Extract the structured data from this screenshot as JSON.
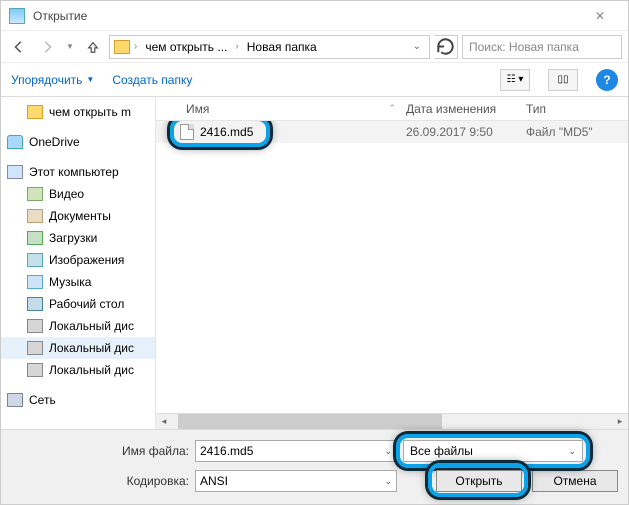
{
  "titlebar": {
    "title": "Открытие"
  },
  "nav": {
    "path_segments": [
      "чем открыть ...",
      "Новая папка"
    ],
    "search_placeholder": "Поиск: Новая папка"
  },
  "toolbar": {
    "organize": "Упорядочить",
    "new_folder": "Создать папку"
  },
  "sidebar": [
    {
      "id": "folder-root",
      "label": "чем открыть m",
      "icon": "folder",
      "indent": 1,
      "hl": false
    },
    {
      "id": "onedrive",
      "label": "OneDrive",
      "icon": "onedrive",
      "indent": 0,
      "hl": false,
      "gap": true
    },
    {
      "id": "this-pc",
      "label": "Этот компьютер",
      "icon": "pc",
      "indent": 0,
      "hl": false,
      "gap": true
    },
    {
      "id": "videos",
      "label": "Видео",
      "icon": "video",
      "indent": 1,
      "hl": false
    },
    {
      "id": "documents",
      "label": "Документы",
      "icon": "doc",
      "indent": 1,
      "hl": false
    },
    {
      "id": "downloads",
      "label": "Загрузки",
      "icon": "down",
      "indent": 1,
      "hl": false
    },
    {
      "id": "pictures",
      "label": "Изображения",
      "icon": "img",
      "indent": 1,
      "hl": false
    },
    {
      "id": "music",
      "label": "Музыка",
      "icon": "music",
      "indent": 1,
      "hl": false
    },
    {
      "id": "desktop",
      "label": "Рабочий стол",
      "icon": "desk",
      "indent": 1,
      "hl": false
    },
    {
      "id": "disk1",
      "label": "Локальный дис",
      "icon": "disk",
      "indent": 1,
      "hl": false
    },
    {
      "id": "disk2",
      "label": "Локальный дис",
      "icon": "disk",
      "indent": 1,
      "hl": true
    },
    {
      "id": "disk3",
      "label": "Локальный дис",
      "icon": "disk",
      "indent": 1,
      "hl": false
    },
    {
      "id": "network",
      "label": "Сеть",
      "icon": "net",
      "indent": 0,
      "hl": false,
      "gap": true
    }
  ],
  "columns": {
    "name": "Имя",
    "date": "Дата изменения",
    "type": "Тип"
  },
  "files": [
    {
      "name": "2416.md5",
      "date": "26.09.2017 9:50",
      "type": "Файл \"MD5\""
    }
  ],
  "form": {
    "filename_label": "Имя файла:",
    "filename_value": "2416.md5",
    "filetype_value": "Все файлы",
    "encoding_label": "Кодировка:",
    "encoding_value": "ANSI",
    "open_btn": "Открыть",
    "cancel_btn": "Отмена"
  }
}
